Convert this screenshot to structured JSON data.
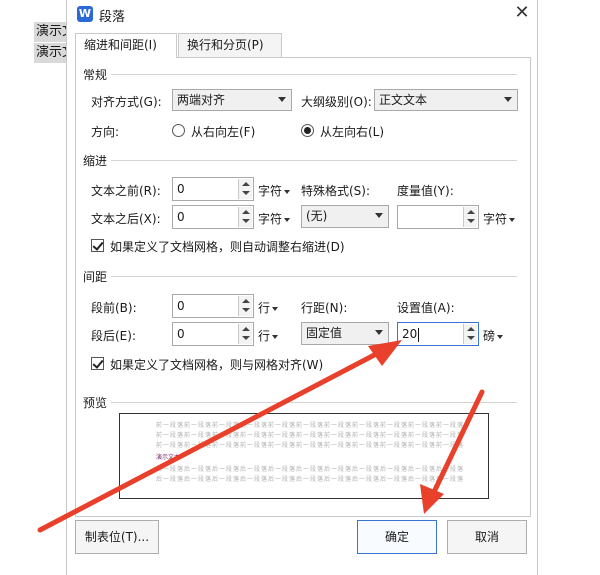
{
  "background": {
    "lines": [
      "演示文",
      "演示文"
    ]
  },
  "dialog": {
    "title": "段落",
    "app_icon_letter": "W",
    "close_glyph": "✕",
    "tabs": [
      "缩进和间距(I)",
      "换行和分页(P)"
    ],
    "general": {
      "heading": "常规",
      "alignment_label": "对齐方式(G):",
      "alignment_value": "两端对齐",
      "outline_label": "大纲级别(O):",
      "outline_value": "正文文本",
      "direction_label": "方向:",
      "rtl_label": "从右向左(F)",
      "ltr_label": "从左向右(L)"
    },
    "indent": {
      "heading": "缩进",
      "before_label": "文本之前(R):",
      "before_value": "0",
      "before_unit": "字符",
      "after_label": "文本之后(X):",
      "after_value": "0",
      "after_unit": "字符",
      "special_label": "特殊格式(S):",
      "special_value": "(无)",
      "measure_label": "度量值(Y):",
      "measure_value": "",
      "measure_unit": "字符",
      "auto_adjust_label": "如果定义了文档网格，则自动调整右缩进(D)"
    },
    "spacing": {
      "heading": "间距",
      "before_label": "段前(B):",
      "before_value": "0",
      "before_unit": "行",
      "after_label": "段后(E):",
      "after_value": "0",
      "after_unit": "行",
      "line_spacing_label": "行距(N):",
      "line_spacing_value": "固定值",
      "set_value_label": "设置值(A):",
      "set_value": "20",
      "set_value_unit": "磅",
      "snap_grid_label": "如果定义了文档网格，则与网格对齐(W)"
    },
    "preview": {
      "heading": "预览",
      "prev_text": "前一段落前一段落前一段落前一段落前一段落前一段落前一段落前一段落前一段落前一段落前一段落",
      "demo_text": "演示文本",
      "next_text": "后一段落后一段落后一段落后一段落后一段落后一段落后一段落后一段落后一段落后一段落后一段落"
    },
    "buttons": {
      "tabs": "制表位(T)...",
      "ok": "确定",
      "cancel": "取消"
    }
  },
  "colors": {
    "annotation_arrow": "#e8402a",
    "focus_border": "#3a73d0"
  }
}
